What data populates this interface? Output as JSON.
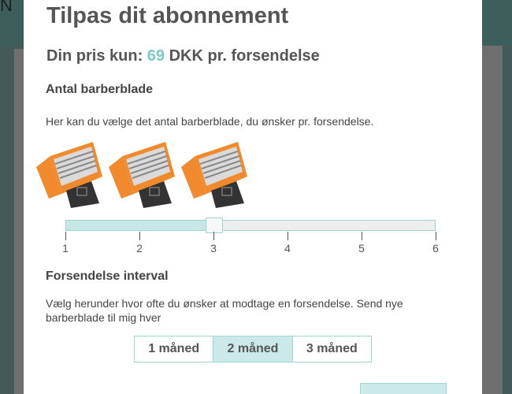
{
  "backdrop": {
    "letter": "N"
  },
  "modal": {
    "title": "Tilpas dit abonnement",
    "price": {
      "prefix": "Din pris kun:",
      "value": "69",
      "suffix": "DKK pr. forsendelse"
    },
    "blades": {
      "heading": "Antal barberblade",
      "description": "Her kan du vælge det antal barberblade, du ønsker pr. forsendelse.",
      "slider": {
        "min": 1,
        "max": 6,
        "value": 3,
        "ticks": [
          "1",
          "2",
          "3",
          "4",
          "5",
          "6"
        ]
      },
      "razor_icons": [
        "razor-cartridge-icon",
        "razor-cartridge-icon",
        "razor-cartridge-icon"
      ],
      "colors": {
        "accent": "#78c9c5",
        "cartridge_orange": "#f08a2c"
      }
    },
    "interval": {
      "heading": "Forsendelse interval",
      "description": "Vælg herunder hvor ofte du ønsker at modtage en forsendelse. Send nye barberblade til mig hver",
      "options": [
        "1 måned",
        "2 måned",
        "3 måned"
      ],
      "selected": "2 måned"
    }
  }
}
